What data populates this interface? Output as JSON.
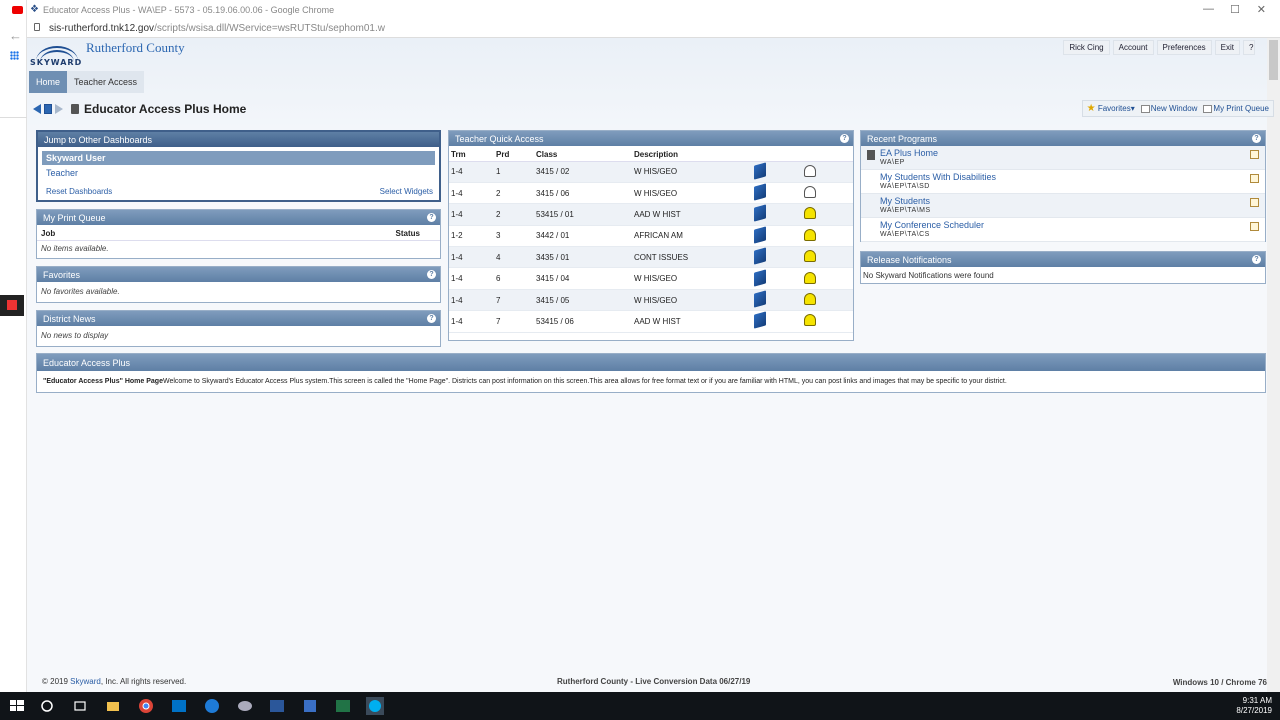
{
  "browser": {
    "tab_title": "Educator Access Plus - WA\\EP - 5573 - 05.19.06.00.06 - Google Chrome",
    "url_host": "sis-rutherford.tnk12.gov",
    "url_path": "/scripts/wsisa.dll/WService=wsRUTStu/sephom01.w"
  },
  "header": {
    "district": "Rutherford County",
    "logo_text": "SKYWARD",
    "links": [
      "Rick Cing",
      "Account",
      "Preferences",
      "Exit",
      "?"
    ]
  },
  "nav": {
    "tabs": [
      {
        "label": "Home",
        "active": true
      },
      {
        "label": "Teacher Access",
        "active": false
      }
    ]
  },
  "page": {
    "title": "Educator Access Plus Home",
    "tools": {
      "favorites": "Favorites",
      "new_window": "New Window",
      "print_queue": "My Print Queue"
    }
  },
  "jump": {
    "title": "Jump to Other Dashboards",
    "selected": "Skyward User",
    "option": "Teacher",
    "reset": "Reset Dashboards",
    "select_widgets": "Select Widgets"
  },
  "print_queue": {
    "title": "My Print Queue",
    "col_job": "Job",
    "col_status": "Status",
    "empty": "No items available."
  },
  "favorites": {
    "title": "Favorites",
    "empty": "No favorites available."
  },
  "district_news": {
    "title": "District News",
    "empty": "No news to display"
  },
  "tqa": {
    "title": "Teacher Quick Access",
    "headers": [
      "Trm",
      "Prd",
      "Class",
      "Description"
    ],
    "rows": [
      {
        "trm": "1-4",
        "prd": "1",
        "class": "3415 / 02",
        "desc": "W HIS/GEO",
        "alert": false
      },
      {
        "trm": "1-4",
        "prd": "2",
        "class": "3415 / 06",
        "desc": "W HIS/GEO",
        "alert": false
      },
      {
        "trm": "1-4",
        "prd": "2",
        "class": "53415 / 01",
        "desc": "AAD W HIST",
        "alert": true
      },
      {
        "trm": "1-2",
        "prd": "3",
        "class": "3442 / 01",
        "desc": "AFRICAN AM",
        "alert": true
      },
      {
        "trm": "1-4",
        "prd": "4",
        "class": "3435 / 01",
        "desc": "CONT ISSUES",
        "alert": true
      },
      {
        "trm": "1-4",
        "prd": "6",
        "class": "3415 / 04",
        "desc": "W HIS/GEO",
        "alert": true
      },
      {
        "trm": "1-4",
        "prd": "7",
        "class": "3415 / 05",
        "desc": "W HIS/GEO",
        "alert": true
      },
      {
        "trm": "1-4",
        "prd": "7",
        "class": "53415 / 06",
        "desc": "AAD W HIST",
        "alert": true
      }
    ]
  },
  "recent": {
    "title": "Recent Programs",
    "items": [
      {
        "name": "EA Plus Home",
        "path": "WA\\EP"
      },
      {
        "name": "My Students With Disabilities",
        "path": "WA\\EP\\TA\\SD"
      },
      {
        "name": "My Students",
        "path": "WA\\EP\\TA\\MS"
      },
      {
        "name": "My Conference Scheduler",
        "path": "WA\\EP\\TA\\CS"
      }
    ]
  },
  "release": {
    "title": "Release Notifications",
    "text": "No Skyward Notifications were found"
  },
  "eap": {
    "title": "Educator Access Plus",
    "bold": "\"Educator Access Plus\" Home Page",
    "text": "Welcome to Skyward's Educator Access Plus system.This screen is called the \"Home Page\". Districts can post information on this screen.This area allows for free format text or if you are familiar with HTML, you can post links and images that may be specific to your district."
  },
  "footer": {
    "copyright_pre": "© 2019 ",
    "copyright_link": "Skyward",
    "copyright_post": ", Inc. All rights reserved.",
    "center": "Rutherford County - Live Conversion Data 06/27/19",
    "right": "Windows 10 / Chrome 76"
  },
  "taskbar": {
    "time": "9:31 AM",
    "date": "8/27/2019"
  }
}
